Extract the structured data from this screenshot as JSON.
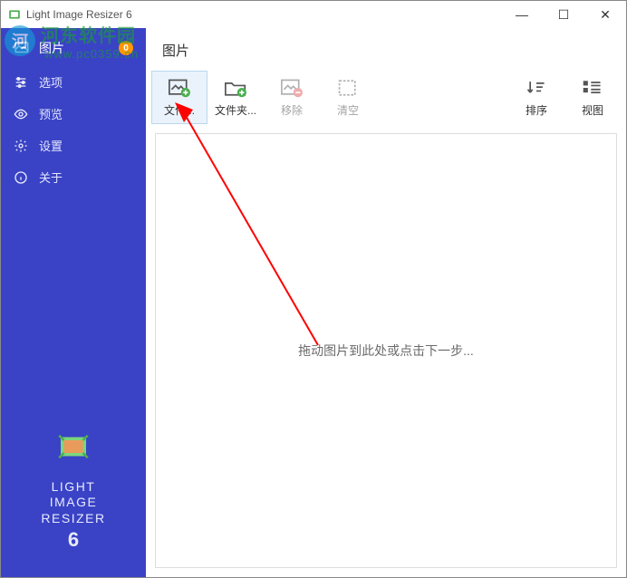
{
  "window": {
    "title": "Light Image Resizer 6",
    "min": "—",
    "max": "☐",
    "close": "✕"
  },
  "sidebar": {
    "header": {
      "label": "图片",
      "badge": "0"
    },
    "items": [
      {
        "label": "选项"
      },
      {
        "label": "预览"
      },
      {
        "label": "设置"
      },
      {
        "label": "关于"
      }
    ],
    "brand": {
      "line1": "LIGHT",
      "line2": "IMAGE",
      "line3": "RESIZER",
      "num": "6"
    }
  },
  "content": {
    "title": "图片",
    "toolbar": {
      "file": {
        "label": "文件..."
      },
      "folder": {
        "label": "文件夹..."
      },
      "remove": {
        "label": "移除"
      },
      "clear": {
        "label": "清空"
      },
      "sort": {
        "label": "排序"
      },
      "view": {
        "label": "视图"
      }
    },
    "drop_hint": "拖动图片到此处或点击下一步..."
  },
  "watermark": {
    "brand": "河东软件园",
    "url": "www.pc0359.cn"
  }
}
